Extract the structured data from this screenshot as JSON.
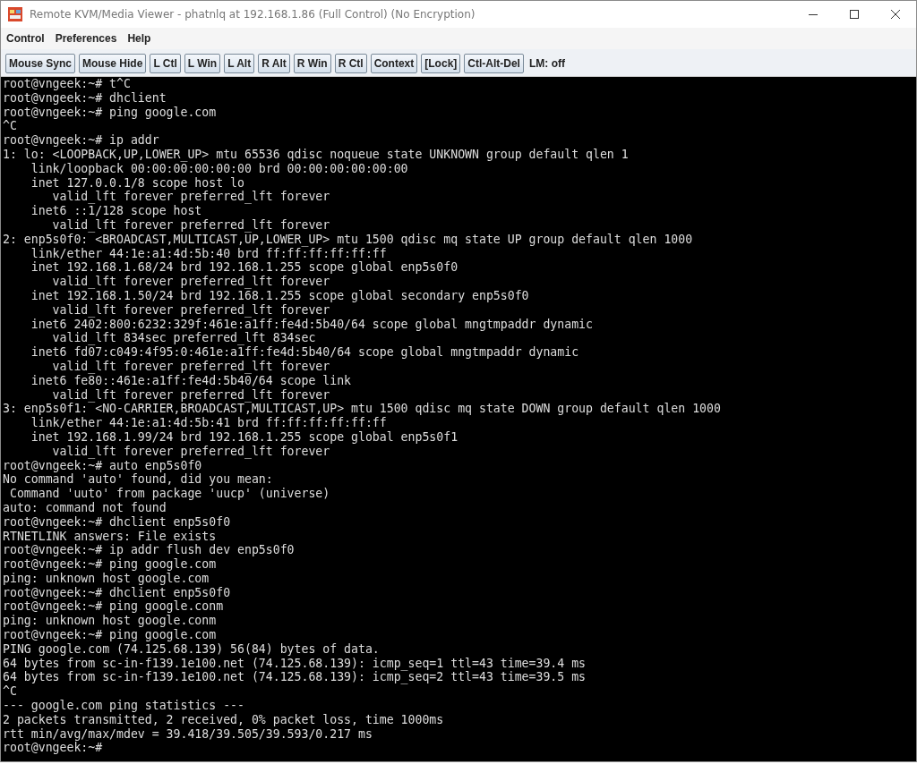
{
  "window": {
    "title": "Remote KVM/Media Viewer - phatnlq at 192.168.1.86 (Full Control) (No Encryption)"
  },
  "menu": [
    "Control",
    "Preferences",
    "Help"
  ],
  "toolbar": {
    "buttons": [
      "Mouse Sync",
      "Mouse Hide",
      "L Ctl",
      "L Win",
      "L Alt",
      "R Alt",
      "R Win",
      "R Ctl",
      "Context",
      "[Lock]",
      "Ctl-Alt-Del"
    ],
    "status": "LM: off"
  },
  "terminal": {
    "lines": [
      "root@vngeek:~# t^C",
      "root@vngeek:~# dhclient",
      "root@vngeek:~# ping google.com",
      "^C",
      "root@vngeek:~# ip addr",
      "1: lo: <LOOPBACK,UP,LOWER_UP> mtu 65536 qdisc noqueue state UNKNOWN group default qlen 1",
      "    link/loopback 00:00:00:00:00:00 brd 00:00:00:00:00:00",
      "    inet 127.0.0.1/8 scope host lo",
      "       valid_lft forever preferred_lft forever",
      "    inet6 ::1/128 scope host",
      "       valid_lft forever preferred_lft forever",
      "2: enp5s0f0: <BROADCAST,MULTICAST,UP,LOWER_UP> mtu 1500 qdisc mq state UP group default qlen 1000",
      "    link/ether 44:1e:a1:4d:5b:40 brd ff:ff:ff:ff:ff:ff",
      "    inet 192.168.1.68/24 brd 192.168.1.255 scope global enp5s0f0",
      "       valid_lft forever preferred_lft forever",
      "    inet 192.168.1.50/24 brd 192.168.1.255 scope global secondary enp5s0f0",
      "       valid_lft forever preferred_lft forever",
      "    inet6 2402:800:6232:329f:461e:a1ff:fe4d:5b40/64 scope global mngtmpaddr dynamic",
      "       valid_lft 834sec preferred_lft 834sec",
      "    inet6 fd07:c049:4f95:0:461e:a1ff:fe4d:5b40/64 scope global mngtmpaddr dynamic",
      "       valid_lft forever preferred_lft forever",
      "    inet6 fe80::461e:a1ff:fe4d:5b40/64 scope link",
      "       valid_lft forever preferred_lft forever",
      "3: enp5s0f1: <NO-CARRIER,BROADCAST,MULTICAST,UP> mtu 1500 qdisc mq state DOWN group default qlen 1000",
      "    link/ether 44:1e:a1:4d:5b:41 brd ff:ff:ff:ff:ff:ff",
      "    inet 192.168.1.99/24 brd 192.168.1.255 scope global enp5s0f1",
      "       valid_lft forever preferred_lft forever",
      "root@vngeek:~# auto enp5s0f0",
      "No command 'auto' found, did you mean:",
      " Command 'uuto' from package 'uucp' (universe)",
      "auto: command not found",
      "root@vngeek:~# dhclient enp5s0f0",
      "RTNETLINK answers: File exists",
      "root@vngeek:~# ip addr flush dev enp5s0f0",
      "root@vngeek:~# ping google.com",
      "ping: unknown host google.com",
      "root@vngeek:~# dhclient enp5s0f0",
      "root@vngeek:~# ping google.conm",
      "ping: unknown host google.conm",
      "root@vngeek:~# ping google.com",
      "PING google.com (74.125.68.139) 56(84) bytes of data.",
      "64 bytes from sc-in-f139.1e100.net (74.125.68.139): icmp_seq=1 ttl=43 time=39.4 ms",
      "64 bytes from sc-in-f139.1e100.net (74.125.68.139): icmp_seq=2 ttl=43 time=39.5 ms",
      "^C",
      "--- google.com ping statistics ---",
      "2 packets transmitted, 2 received, 0% packet loss, time 1000ms",
      "rtt min/avg/max/mdev = 39.418/39.505/39.593/0.217 ms",
      "root@vngeek:~#"
    ]
  }
}
